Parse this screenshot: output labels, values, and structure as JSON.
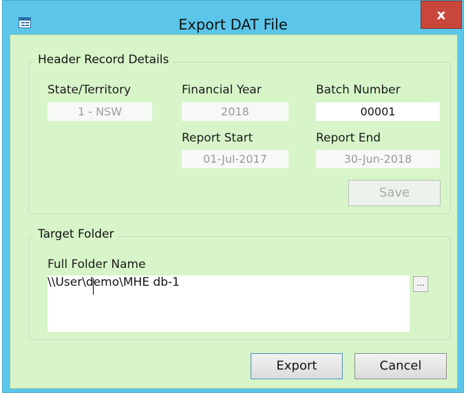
{
  "window": {
    "title": "Export DAT File",
    "close_glyph": "x"
  },
  "header_group": {
    "legend": "Header Record Details",
    "state_label": "State/Territory",
    "state_value": "1 - NSW",
    "financial_year_label": "Financial Year",
    "financial_year_value": "2018",
    "batch_number_label": "Batch Number",
    "batch_number_value": "00001",
    "report_start_label": "Report Start",
    "report_start_value": "01-Jul-2017",
    "report_end_label": "Report End",
    "report_end_value": "30-Jun-2018",
    "save_label": "Save"
  },
  "target_group": {
    "legend": "Target Folder",
    "folder_label": "Full Folder Name",
    "folder_value": "\\\\User\\demo\\MHE db-1",
    "browse_label": "..."
  },
  "footer": {
    "export_label": "Export",
    "cancel_label": "Cancel"
  },
  "icons": {
    "title_icon": "form-icon",
    "close_icon": "close-icon"
  },
  "colors": {
    "titlebar": "#5bc6ea",
    "client_bg": "#d7f5c8",
    "close_bg": "#c9473a"
  }
}
